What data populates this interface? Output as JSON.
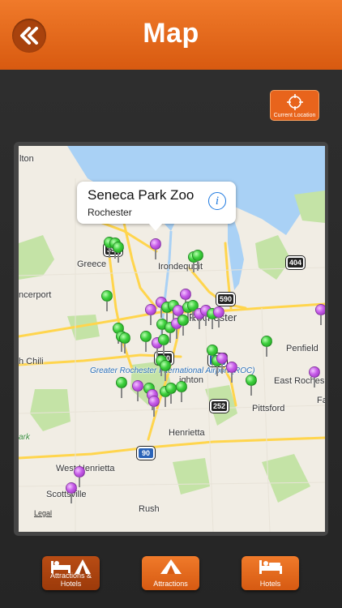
{
  "header": {
    "title": "Map",
    "back_icon": "double-chevron-left-icon"
  },
  "current_location": {
    "label": "Current Location",
    "icon": "crosshair-icon"
  },
  "map": {
    "callout": {
      "title": "Seneca Park Zoo",
      "subtitle": "Rochester",
      "info_glyph": "i"
    },
    "places": {
      "hilton": "lton",
      "greece": "Greece",
      "irondequoit": "Irondequoit",
      "spencerport": "ncerport",
      "rochester": "Rochester",
      "north_chili": "h Chili",
      "penfield": "Penfield",
      "east_rochester": "East Roches",
      "fairport": "Fa",
      "brighton": "ighton",
      "pittsford": "Pittsford",
      "henrietta": "Henrietta",
      "west_henrietta": "West Henrietta",
      "scottsville": "Scottsville",
      "rush": "Rush",
      "airport": "Greater Rochester International Airport (ROC)",
      "park": "ark"
    },
    "shields": {
      "s390": "390",
      "s404": "404",
      "s590": "590",
      "s490": "490",
      "s590b": "590",
      "s252": "252",
      "s90": "90"
    },
    "legal": "Legal",
    "colors": {
      "water": "#a9d1f5",
      "park": "#c4e3a6",
      "land": "#f1ede4",
      "road": "#ffd54d",
      "pin_green": "#3ccf3c",
      "pin_purple": "#c65ae8"
    }
  },
  "tabs": [
    {
      "label": "Attractions & Hotels",
      "icon": "bed-and-tent-icon",
      "selected": true
    },
    {
      "label": "Attractions",
      "icon": "tent-icon",
      "selected": false
    },
    {
      "label": "Hotels",
      "icon": "bed-icon",
      "selected": false
    }
  ]
}
